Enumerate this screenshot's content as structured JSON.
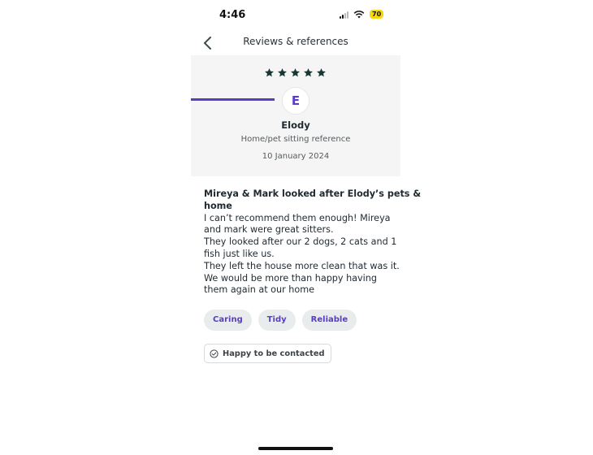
{
  "status_bar": {
    "time": "4:46",
    "battery": "70"
  },
  "header": {
    "title": "Reviews & references",
    "back_icon": "chevron-left-icon"
  },
  "reference": {
    "rating": 5,
    "rating_max": 5,
    "avatar_letter": "E",
    "name": "Elody",
    "type": "Home/pet sitting reference",
    "date": "10 January 2024"
  },
  "review": {
    "heading_lines": [
      "Mireya & Mark  looked after Elody’s pets &",
      "home"
    ],
    "body_lines": [
      "I can’t recommend them enough! Mireya",
      "and mark were great sitters.",
      "They looked after our 2 dogs,  2 cats and 1",
      "fish just like us.",
      "They left the house more clean that was it.",
      "We would be more than happy having",
      "them again at our home"
    ]
  },
  "tags": [
    "Caring",
    "Tidy",
    "Reliable"
  ],
  "contact_badge": {
    "label": "Happy to be contacted",
    "icon": "check-circle-icon"
  },
  "colors": {
    "accent": "#5b3cc4",
    "star": "#173636",
    "card_bg": "#f4f5f4",
    "tag_bg": "#e8ecec"
  }
}
